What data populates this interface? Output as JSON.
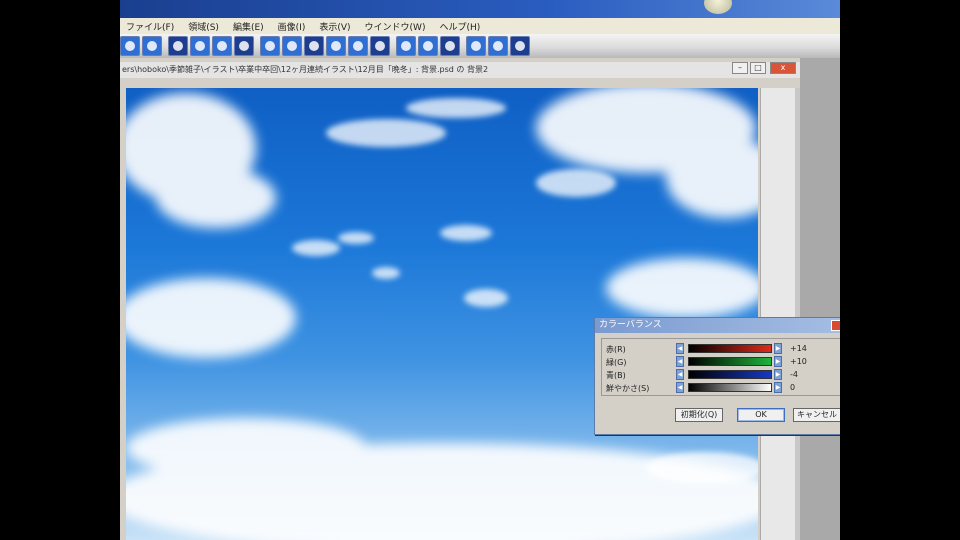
{
  "menu": [
    "ファイル(F)",
    "領域(S)",
    "編集(E)",
    "画像(I)",
    "表示(V)",
    "ウインドウ(W)",
    "ヘルプ(H)"
  ],
  "doc_title": "ers\\hoboko\\季節雑子\\イラスト\\卒業中卒回\\12ヶ月連続イラスト\\12月目「晩冬」: 背景.psd の 背景2",
  "window_buttons": {
    "minimize": "–",
    "restore": "□",
    "close": "x"
  },
  "dialog": {
    "title": "カラーバランス",
    "close": "x",
    "rows": [
      {
        "label": "赤(R)",
        "value": "+14",
        "color": "#e02a1a"
      },
      {
        "label": "緑(G)",
        "value": "+10",
        "color": "#1fb33c"
      },
      {
        "label": "青(B)",
        "value": "-4",
        "color": "#1638c8"
      },
      {
        "label": "鮮やかさ(S)",
        "value": "0",
        "color": "#ffffff"
      }
    ],
    "reset_label": "初期化(Q)",
    "ok_label": "OK",
    "cancel_label": "キャンセル"
  },
  "toolbar_icons": [
    "layer-icon",
    "globe-icon",
    "folder-icon",
    "image-icon",
    "cloud-icon",
    "copy-icon",
    "brush-icon",
    "filter-icon",
    "zoom-icon",
    "pen-icon",
    "gradient-icon",
    "stamp-icon",
    "scissors-icon",
    "eraser-icon",
    "color-icon",
    "rotate-icon",
    "search-icon",
    "settings-icon"
  ],
  "colors": {
    "toolbar_blue": "#2f6fd4",
    "toolbar_dark": "#1d3d8f",
    "close_red": "#d84b31"
  }
}
